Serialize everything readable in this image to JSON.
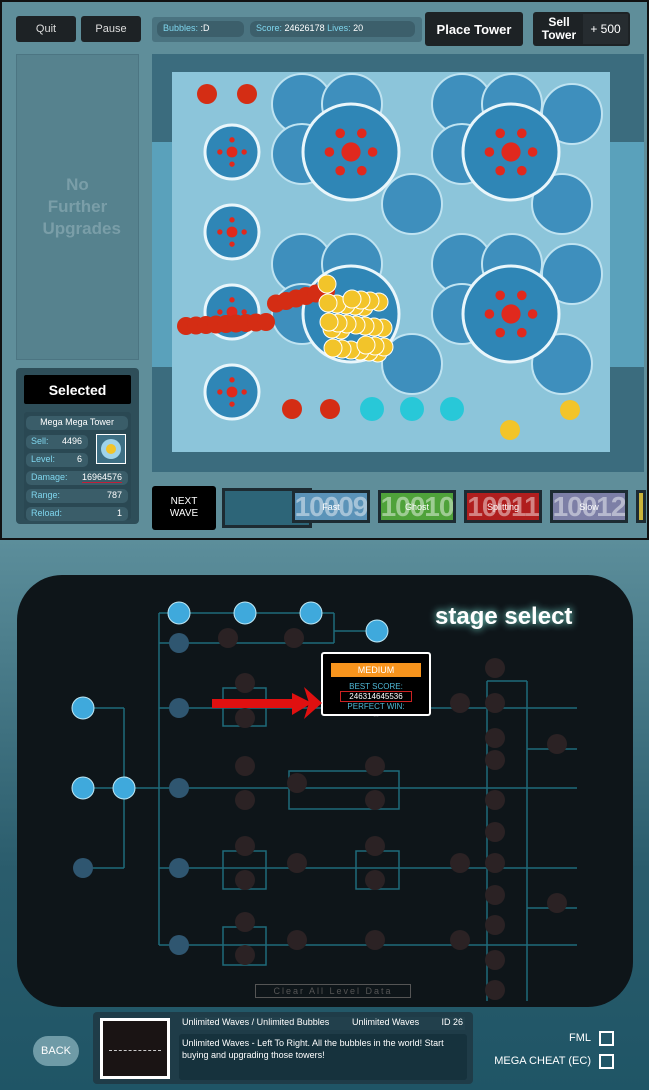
{
  "hud": {
    "quit": "Quit",
    "pause": "Pause",
    "bubbles_label": "Bubbles:",
    "bubbles_value": ":D",
    "score_label": "Score:",
    "score_value": "24626178",
    "lives_label": "Lives:",
    "lives_value": "20",
    "place_tower": "Place Tower",
    "sell_tower": "Sell Tower",
    "sell_value": "+ 500"
  },
  "upgrade_panel": {
    "text": "No Further Upgrades"
  },
  "selected": {
    "title": "Selected",
    "tower_name": "Mega Mega Tower",
    "sell_label": "Sell:",
    "sell": "4496",
    "level_label": "Level:",
    "level": "6",
    "damage_label": "Damage:",
    "damage": "16964576",
    "range_label": "Range:",
    "range": "787",
    "reload_label": "Reload:",
    "reload": "1"
  },
  "waves": {
    "next_wave": "NEXT WAVE",
    "items": [
      {
        "num": "10009",
        "label": "Fast",
        "color": "#5b93b8"
      },
      {
        "num": "10010",
        "label": "Ghost",
        "color": "#4fa23a"
      },
      {
        "num": "10011",
        "label": "Splitting",
        "color": "#b01e1e"
      },
      {
        "num": "10012",
        "label": "Slow",
        "color": "#7d7fa6"
      }
    ]
  },
  "stage_select": {
    "title": "stage select",
    "popup": {
      "difficulty": "MEDIUM",
      "best_score_label": "BEST SCORE:",
      "best_score": "246314645536",
      "perfect_win_label": "PERFECT WIN:",
      "perfect_win": "--"
    },
    "clear_data": "Clear All Level Data"
  },
  "level_info": {
    "name": "Unlimited Waves / Unlimited Bubbles",
    "mode": "Unlimited Waves",
    "id": "ID 26",
    "description": "Unlimited Waves - Left To Right.  All the bubbles in the world! Start buying and upgrading those towers!"
  },
  "options": {
    "fml": "FML",
    "mega_cheat": "MEGA CHEAT (EC)"
  },
  "back": "BACK",
  "colors": {
    "accent_orange": "#f7941d",
    "bubble_blue": "#3fa9dc",
    "arrow_red": "#e01010"
  }
}
